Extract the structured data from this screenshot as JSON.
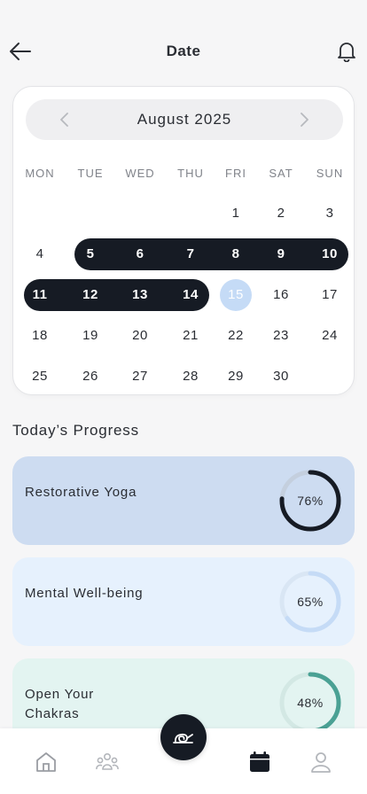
{
  "header": {
    "title": "Date"
  },
  "calendar": {
    "month_label": "August 2025",
    "weekdays": [
      "MON",
      "TUE",
      "WED",
      "THU",
      "FRI",
      "SAT",
      "SUN"
    ],
    "weeks": [
      [
        "",
        "",
        "",
        "",
        "1",
        "2",
        "3"
      ],
      [
        "4",
        "5",
        "6",
        "7",
        "8",
        "9",
        "10"
      ],
      [
        "11",
        "12",
        "13",
        "14",
        "15",
        "16",
        "17"
      ],
      [
        "18",
        "19",
        "20",
        "21",
        "22",
        "23",
        "24"
      ],
      [
        "25",
        "26",
        "27",
        "28",
        "29",
        "30",
        ""
      ]
    ],
    "selected_range": [
      "5",
      "14"
    ],
    "today": "15",
    "colors": {
      "selected_bg": "#161b24",
      "today_bg": "#c5dbf6"
    }
  },
  "progress": {
    "section_title": "Today’s Progress",
    "items": [
      {
        "title": "Restorative Yoga",
        "percent": 76,
        "percent_label": "76%",
        "bg": "#cddcf1",
        "track": "#c4cfde",
        "fill": "#161b24"
      },
      {
        "title": "Mental Well-being",
        "percent": 65,
        "percent_label": "65%",
        "bg": "#e6f1fd",
        "track": "#d9e6f4",
        "fill": "#c5dbf6"
      },
      {
        "title": "Open Your Chakras",
        "percent": 48,
        "percent_label": "48%",
        "bg": "#e3f4f1",
        "track": "#d3e8e4",
        "fill": "#4aa194"
      }
    ]
  },
  "nav": {
    "items": [
      "home-icon",
      "community-icon",
      "yoga-mat-icon",
      "calendar-icon",
      "profile-icon"
    ],
    "active": "calendar-icon"
  }
}
